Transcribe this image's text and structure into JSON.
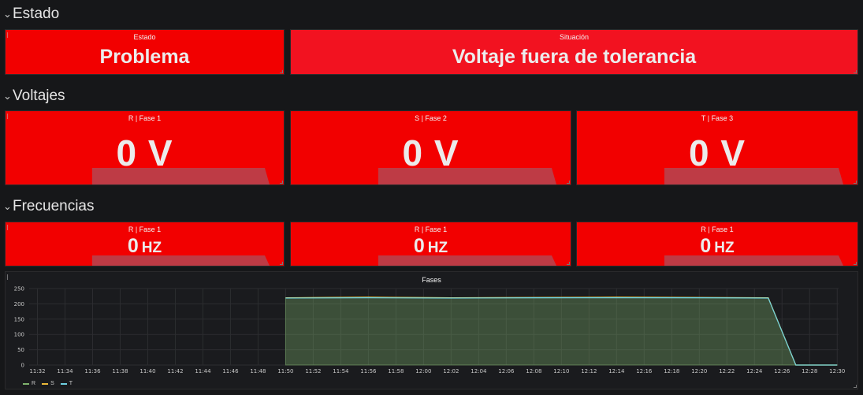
{
  "rows": {
    "estado": "Estado",
    "voltajes": "Voltajes",
    "frecuencias": "Frecuencias"
  },
  "estado": {
    "estado_title": "Estado",
    "estado_value": "Problema",
    "situacion_title": "Situación",
    "situacion_value": "Voltaje fuera de tolerancia"
  },
  "voltajes": [
    {
      "title": "R | Fase 1",
      "value": "0 V"
    },
    {
      "title": "S | Fase 2",
      "value": "0 V"
    },
    {
      "title": "T | Fase 3",
      "value": "0 V"
    }
  ],
  "frecuencias": [
    {
      "title": "R | Fase 1",
      "value": "0",
      "unit": "HZ"
    },
    {
      "title": "R | Fase 1",
      "value": "0",
      "unit": "HZ"
    },
    {
      "title": "R | Fase 1",
      "value": "0",
      "unit": "HZ"
    }
  ],
  "colors": {
    "alert_red": "#f20000",
    "series_r": "#7eb26d",
    "series_s": "#eab839",
    "series_t": "#6ed0e0"
  },
  "chart_data": {
    "type": "line",
    "title": "Fases",
    "ylim": [
      0,
      250
    ],
    "yticks": [
      0,
      50,
      100,
      150,
      200,
      250
    ],
    "categories": [
      "11:32",
      "11:34",
      "11:36",
      "11:38",
      "11:40",
      "11:42",
      "11:44",
      "11:46",
      "11:48",
      "11:50",
      "11:52",
      "11:54",
      "11:56",
      "11:58",
      "12:00",
      "12:02",
      "12:04",
      "12:06",
      "12:08",
      "12:10",
      "12:12",
      "12:14",
      "12:16",
      "12:18",
      "12:20",
      "12:22",
      "12:24",
      "12:26",
      "12:28",
      "12:30"
    ],
    "series": [
      {
        "name": "R",
        "color": "#7eb26d",
        "x": [
          "11:50",
          "11:56",
          "12:02",
          "12:08",
          "12:14",
          "12:20",
          "12:25",
          "12:27",
          "12:30"
        ],
        "values": [
          220,
          221,
          220,
          220,
          221,
          220,
          220,
          0,
          0
        ]
      },
      {
        "name": "S",
        "color": "#eab839",
        "x": [
          "11:50",
          "11:56",
          "12:02",
          "12:08",
          "12:14",
          "12:20",
          "12:25",
          "12:27",
          "12:30"
        ],
        "values": [
          220,
          222,
          220,
          221,
          222,
          221,
          220,
          0,
          0
        ]
      },
      {
        "name": "T",
        "color": "#6ed0e0",
        "x": [
          "11:50",
          "11:56",
          "12:02",
          "12:08",
          "12:14",
          "12:20",
          "12:25",
          "12:27",
          "12:30"
        ],
        "values": [
          219,
          220,
          219,
          220,
          220,
          220,
          219,
          0,
          0
        ]
      }
    ],
    "legend": "bottom-left",
    "grid": true
  }
}
